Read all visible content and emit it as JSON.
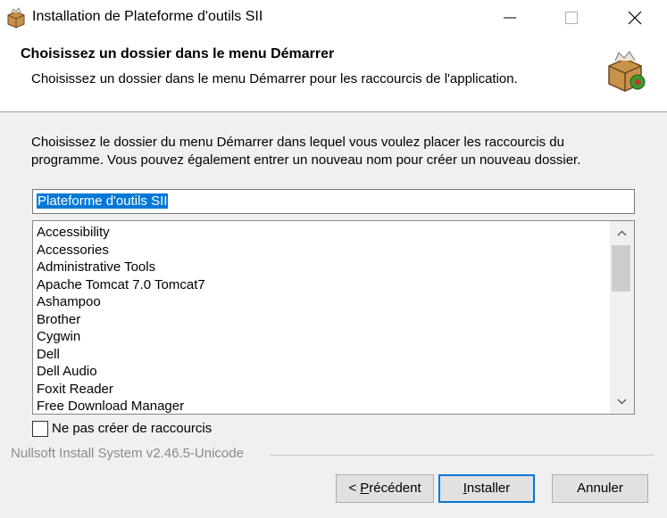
{
  "window": {
    "title": "Installation de Plateforme d'outils SII",
    "icon": "installer-box-icon"
  },
  "header": {
    "title": "Choisissez un dossier dans le menu Démarrer",
    "subtitle": "Choisissez un dossier dans le menu Démarrer pour les raccourcis de l'application.",
    "icon": "installer-box-icon"
  },
  "content": {
    "description": "Choisissez le dossier du menu Démarrer dans lequel vous voulez placer les raccourcis du programme. Vous pouvez également entrer un nouveau nom pour créer un nouveau dossier.",
    "folder_value": "Plateforme d'outils SII",
    "folders": [
      "Accessibility",
      "Accessories",
      "Administrative Tools",
      "Apache Tomcat 7.0 Tomcat7",
      "Ashampoo",
      "Brother",
      "Cygwin",
      "Dell",
      "Dell Audio",
      "Foxit Reader",
      "Free Download Manager"
    ],
    "no_shortcuts_label": "Ne pas créer de raccourcis",
    "no_shortcuts_checked": false
  },
  "branding": "Nullsoft Install System v2.46.5-Unicode",
  "buttons": {
    "prev_prefix": "< ",
    "prev_accel": "P",
    "prev_rest": "récédent",
    "install_accel": "I",
    "install_rest": "nstaller",
    "cancel": "Annuler"
  }
}
